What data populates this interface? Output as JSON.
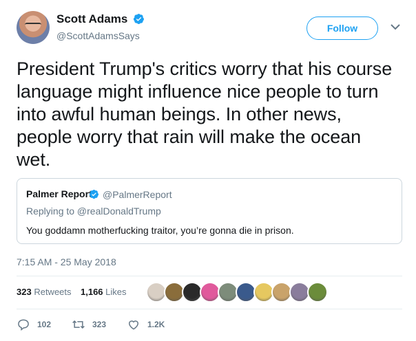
{
  "author": {
    "display_name": "Scott Adams",
    "screen_name": "@ScottAdamsSays",
    "verified": true
  },
  "follow_label": "Follow",
  "tweet": {
    "lines": [
      "President Trump's critics worry that his course",
      "language might influence nice people to turn",
      "into awful human beings. In other news,",
      "people worry that rain will make the ocean",
      "wet."
    ]
  },
  "quoted": {
    "display_name": "Palmer Report",
    "screen_name": "@PalmerReport",
    "replying_to": "Replying to @realDonaldTrump",
    "text": "You goddamn motherfucking traitor, you’re gonna die in prison."
  },
  "timestamp": "7:15 AM - 25 May 2018",
  "stats": {
    "retweets_count": "323",
    "retweets_label": "Retweets",
    "likes_count": "1,166",
    "likes_label": "Likes"
  },
  "liker_avatars": [
    "#d9cfc4",
    "#8a6d3b",
    "#2a2a2a",
    "#e05a9c",
    "#7d8c7a",
    "#3a5a8c",
    "#e6c860",
    "#c9a36a",
    "#8a7d9c",
    "#6b8c3a"
  ],
  "actions": {
    "reply_count": "102",
    "retweet_count": "323",
    "like_count": "1.2K"
  },
  "colors": {
    "accent": "#1da1f2",
    "secondary_text": "#657786",
    "primary_text": "#14171a"
  }
}
